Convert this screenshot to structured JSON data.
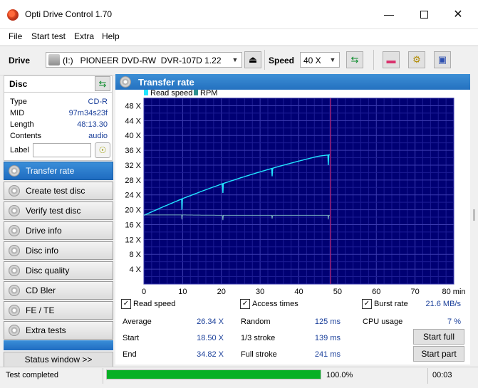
{
  "window": {
    "title": "Opti Drive Control 1.70"
  },
  "menu": [
    "File",
    "Start test",
    "Extra",
    "Help"
  ],
  "toolbar": {
    "drive_label": "Drive",
    "drive_value": "(I:)   PIONEER DVD-RW  DVR-107D 1.22",
    "speed_label": "Speed",
    "speed_value": "40 X"
  },
  "disc": {
    "header": "Disc",
    "type_label": "Type",
    "type_value": "CD-R",
    "mid_label": "MID",
    "mid_value": "97m34s23f",
    "length_label": "Length",
    "length_value": "48:13.30",
    "contents_label": "Contents",
    "contents_value": "audio",
    "label_label": "Label",
    "label_value": ""
  },
  "nav": [
    {
      "label": "Transfer rate",
      "active": true
    },
    {
      "label": "Create test disc"
    },
    {
      "label": "Verify test disc"
    },
    {
      "label": "Drive info"
    },
    {
      "label": "Disc info"
    },
    {
      "label": "Disc quality"
    },
    {
      "label": "CD Bler"
    },
    {
      "label": "FE / TE"
    },
    {
      "label": "Extra tests"
    }
  ],
  "status_window_label": "Status window >>",
  "panel_title": "Transfer rate",
  "chart_data": {
    "type": "line",
    "legend": [
      "Read speed",
      "RPM"
    ],
    "legend_placement": "top-left",
    "xlabel_unit": "min",
    "xlim": [
      0,
      80
    ],
    "ylim": [
      0,
      50
    ],
    "x_ticks": [
      0,
      10,
      20,
      30,
      40,
      50,
      60,
      70,
      80
    ],
    "y_ticks": [
      4,
      8,
      12,
      16,
      20,
      24,
      28,
      32,
      36,
      40,
      44,
      48
    ],
    "y_tick_suffix": " X",
    "x_tick_last_label": "80 min",
    "grid": true,
    "marker_x": 48.2,
    "series": [
      {
        "name": "Read speed",
        "color": "#22e5ff",
        "x": [
          0,
          5,
          10,
          15,
          20,
          25,
          30,
          35,
          40,
          45,
          48.2
        ],
        "y": [
          18.5,
          20.8,
          23.0,
          25.0,
          26.9,
          28.6,
          30.2,
          31.7,
          33.1,
          34.4,
          34.82
        ],
        "dips": [
          [
            9.8,
            20.0
          ],
          [
            20.4,
            24.5
          ],
          [
            33.1,
            29.0
          ],
          [
            47.6,
            32.0
          ]
        ]
      },
      {
        "name": "RPM",
        "color": "#78b0c0",
        "x": [
          0,
          10,
          20,
          30,
          40,
          48.2
        ],
        "y": [
          18.6,
          18.6,
          18.5,
          18.5,
          18.5,
          18.5
        ],
        "dips": [
          [
            9.8,
            17.4
          ],
          [
            20.4,
            17.2
          ],
          [
            33.1,
            17.6
          ],
          [
            47.6,
            17.4
          ]
        ]
      }
    ]
  },
  "stats": {
    "read_speed_label": "Read speed",
    "access_times_label": "Access times",
    "burst_rate_label": "Burst rate",
    "burst_rate_value": "21.6 MB/s",
    "average_label": "Average",
    "average_value": "26.34 X",
    "start_label": "Start",
    "start_value": "18.50 X",
    "end_label": "End",
    "end_value": "34.82 X",
    "random_label": "Random",
    "random_value": "125 ms",
    "third_label": "1/3 stroke",
    "third_value": "139 ms",
    "full_label": "Full stroke",
    "full_value": "241 ms",
    "cpu_label": "CPU usage",
    "cpu_value": "7 %",
    "start_full_label": "Start full",
    "start_part_label": "Start part"
  },
  "statusbar": {
    "text": "Test completed",
    "progress_pct": 100,
    "progress_label": "100.0%",
    "time": "00:03"
  }
}
